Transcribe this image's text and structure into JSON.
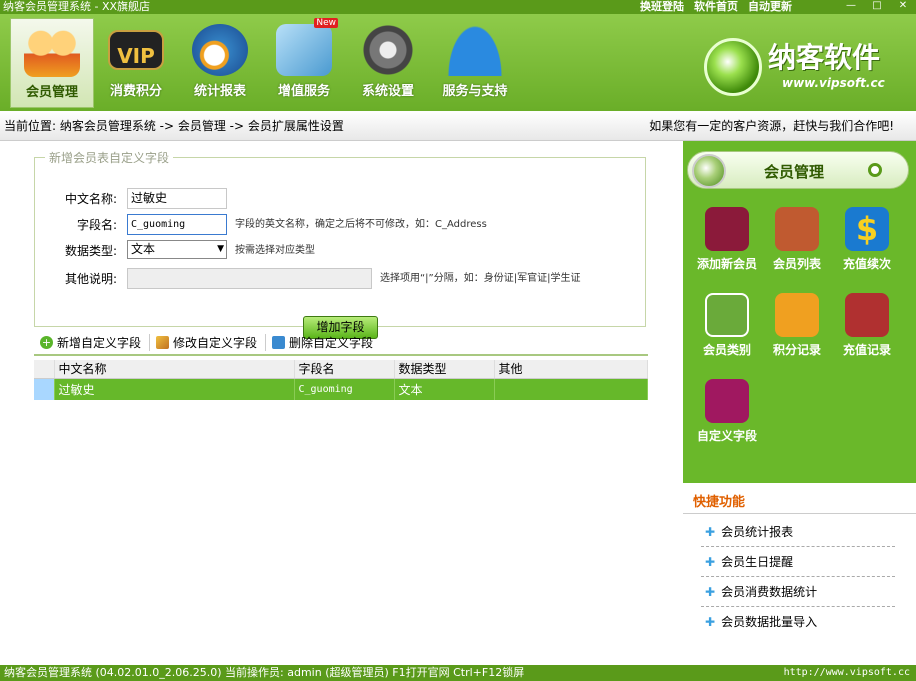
{
  "window": {
    "title": "纳客会员管理系统 - XX旗舰店",
    "top_links": [
      "换班登陆",
      "软件首页",
      "自动更新"
    ]
  },
  "toolbar": {
    "items": [
      {
        "label": "会员管理",
        "icon": "members-icon"
      },
      {
        "label": "消费积分",
        "icon": "vip-card-icon"
      },
      {
        "label": "统计报表",
        "icon": "globe-clock-icon"
      },
      {
        "label": "增值服务",
        "icon": "value-added-icon",
        "badge": "New"
      },
      {
        "label": "系统设置",
        "icon": "gears-icon"
      },
      {
        "label": "服务与支持",
        "icon": "umbrella-icon"
      }
    ],
    "brand": {
      "name": "纳客软件",
      "url": "www.vipsoft.cc"
    }
  },
  "breadcrumb": {
    "text": "当前位置: 纳客会员管理系统 -> 会员管理 -> 会员扩展属性设置",
    "slogan": "如果您有一定的客户资源，赶快与我们合作吧!"
  },
  "form": {
    "legend": "新增会员表自定义字段",
    "chinese_name_label": "中文名称:",
    "chinese_name_value": "过敏史",
    "field_name_label": "字段名:",
    "field_name_value": "C_guoming",
    "field_name_hint": "字段的英文名称，确定之后将不可修改，如：C_Address",
    "data_type_label": "数据类型:",
    "data_type_value": "文本",
    "data_type_hint": "按需选择对应类型",
    "other_label": "其他说明:",
    "other_value": "",
    "other_hint": "选择项用“|”分隔，如：身份证|军官证|学生证",
    "add_button": "增加字段"
  },
  "actions": {
    "add": "新增自定义字段",
    "edit": "修改自定义字段",
    "delete": "删除自定义字段"
  },
  "table": {
    "headers": [
      "中文名称",
      "字段名",
      "数据类型",
      "其他"
    ],
    "rows": [
      {
        "chinese_name": "过敏史",
        "field_name": "C_guoming",
        "data_type": "文本",
        "other": ""
      }
    ]
  },
  "right_panel": {
    "title": "会员管理",
    "buttons": [
      {
        "label": "添加新会员",
        "icon": "add-member-icon",
        "color": "#8b1a3a"
      },
      {
        "label": "会员列表",
        "icon": "member-list-icon",
        "color": "#c05a30"
      },
      {
        "label": "充值续次",
        "icon": "dollar-icon",
        "color": "#1a7ad0"
      },
      {
        "label": "会员类别",
        "icon": "member-category-icon",
        "color": "#6aaa3a"
      },
      {
        "label": "积分记录",
        "icon": "points-truck-icon",
        "color": "#f0a020"
      },
      {
        "label": "充值记录",
        "icon": "recharge-record-icon",
        "color": "#b03030"
      },
      {
        "label": "自定义字段",
        "icon": "custom-field-icon",
        "color": "#a01860"
      }
    ],
    "quick_title": "快捷功能",
    "quick_items": [
      "会员统计报表",
      "会员生日提醒",
      "会员消费数据统计",
      "会员数据批量导入"
    ]
  },
  "statusbar": {
    "text": "纳客会员管理系统 (04.02.01.0_2.06.25.0)  当前操作员: admin (超级管理员)  F1打开官网 Ctrl+F12锁屏",
    "url": "http://www.vipsoft.cc"
  }
}
